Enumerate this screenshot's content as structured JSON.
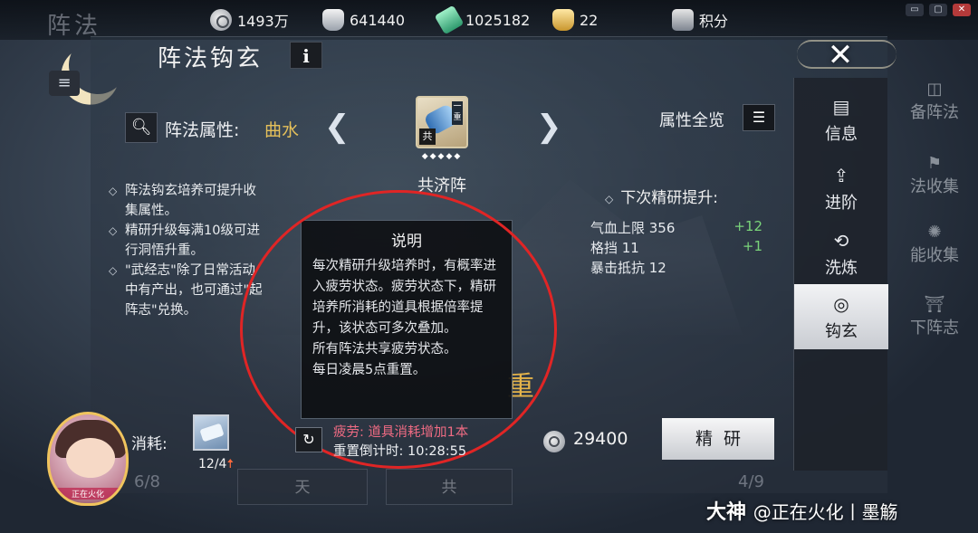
{
  "topbar": {
    "resources": [
      {
        "icon": "silver-coin-icon",
        "value": "1493万"
      },
      {
        "icon": "silver-ingot-icon",
        "value": "641440"
      },
      {
        "icon": "jade-icon",
        "value": "1025182"
      },
      {
        "icon": "gold-ingot-icon",
        "value": "22"
      },
      {
        "icon": "points-badge-icon",
        "value": "积分"
      }
    ],
    "window_buttons": [
      "▭",
      "▢",
      "✕"
    ]
  },
  "background": {
    "ghost_title": "阵法",
    "ghost_info": "i"
  },
  "panel": {
    "title": "阵法钩玄",
    "info_label": "i",
    "close_label": "✕",
    "attribute": {
      "label": "阵法属性:",
      "value": "曲水"
    },
    "formation": {
      "name": "共济阵",
      "tag": "一重",
      "badge": "共",
      "stars": "◆◆◆◆◆"
    },
    "overview_label": "属性全览",
    "description": [
      "阵法钩玄培养可提升收集属性。",
      "精研升级每满10级可进行洞悟升重。",
      "\"武经志\"除了日常活动中有产出，也可通过\"起阵志\"兑换。"
    ],
    "next_refine": {
      "title": "下次精研提升:",
      "stats": [
        {
          "name": "气血上限 356",
          "inc": "+12"
        },
        {
          "name": "格挡 11",
          "inc": "+1"
        },
        {
          "name": "暴击抵抗 12",
          "inc": ""
        }
      ]
    },
    "tooltip": {
      "title": "说明",
      "body": "每次精研升级培养时，有概率进入疲劳状态。疲劳状态下，精研培养所消耗的道具根据倍率提升，该状态可多次叠加。\n所有阵法共享疲劳状态。\n每日凌晨5点重置。"
    },
    "big_char": "重",
    "consume": {
      "label": "消耗:",
      "count": "12/4",
      "up_arrow": "🠅"
    },
    "fatigue": {
      "text": "疲劳: 道具消耗增加1本",
      "reset": "重置倒计时: 10:28:55"
    },
    "cost": "29400",
    "refine_button": "精研",
    "faded": {
      "left_num": "6/8",
      "btn1": "天",
      "btn2": "共",
      "right_num": "4/9"
    }
  },
  "tabs": [
    {
      "icon": "scroll-info-icon",
      "glyph": "▤",
      "label": "信息"
    },
    {
      "icon": "advance-icon",
      "glyph": "⇪",
      "label": "进阶"
    },
    {
      "icon": "refresh-icon",
      "glyph": "⟲",
      "label": "洗炼"
    },
    {
      "icon": "yinyang-icon",
      "glyph": "◎",
      "label": "钩玄"
    }
  ],
  "far_tabs": [
    {
      "icon": "prepare-icon",
      "glyph": "◫",
      "label": "备阵法"
    },
    {
      "icon": "flag-icon",
      "glyph": "⚑",
      "label": "法收集"
    },
    {
      "icon": "flame-icon",
      "glyph": "✺",
      "label": "能收集"
    },
    {
      "icon": "gate-icon",
      "glyph": "⛩",
      "label": "下阵志"
    }
  ],
  "avatar": {
    "label": "正在火化"
  },
  "watermark": {
    "brand": "大神",
    "text": "@正在火化丨墨觞"
  },
  "colors": {
    "accent_gold": "#e5c05a",
    "increase_green": "#7ad47a",
    "fatigue_pink": "#ef6b83",
    "annotation_red": "#e02525"
  }
}
